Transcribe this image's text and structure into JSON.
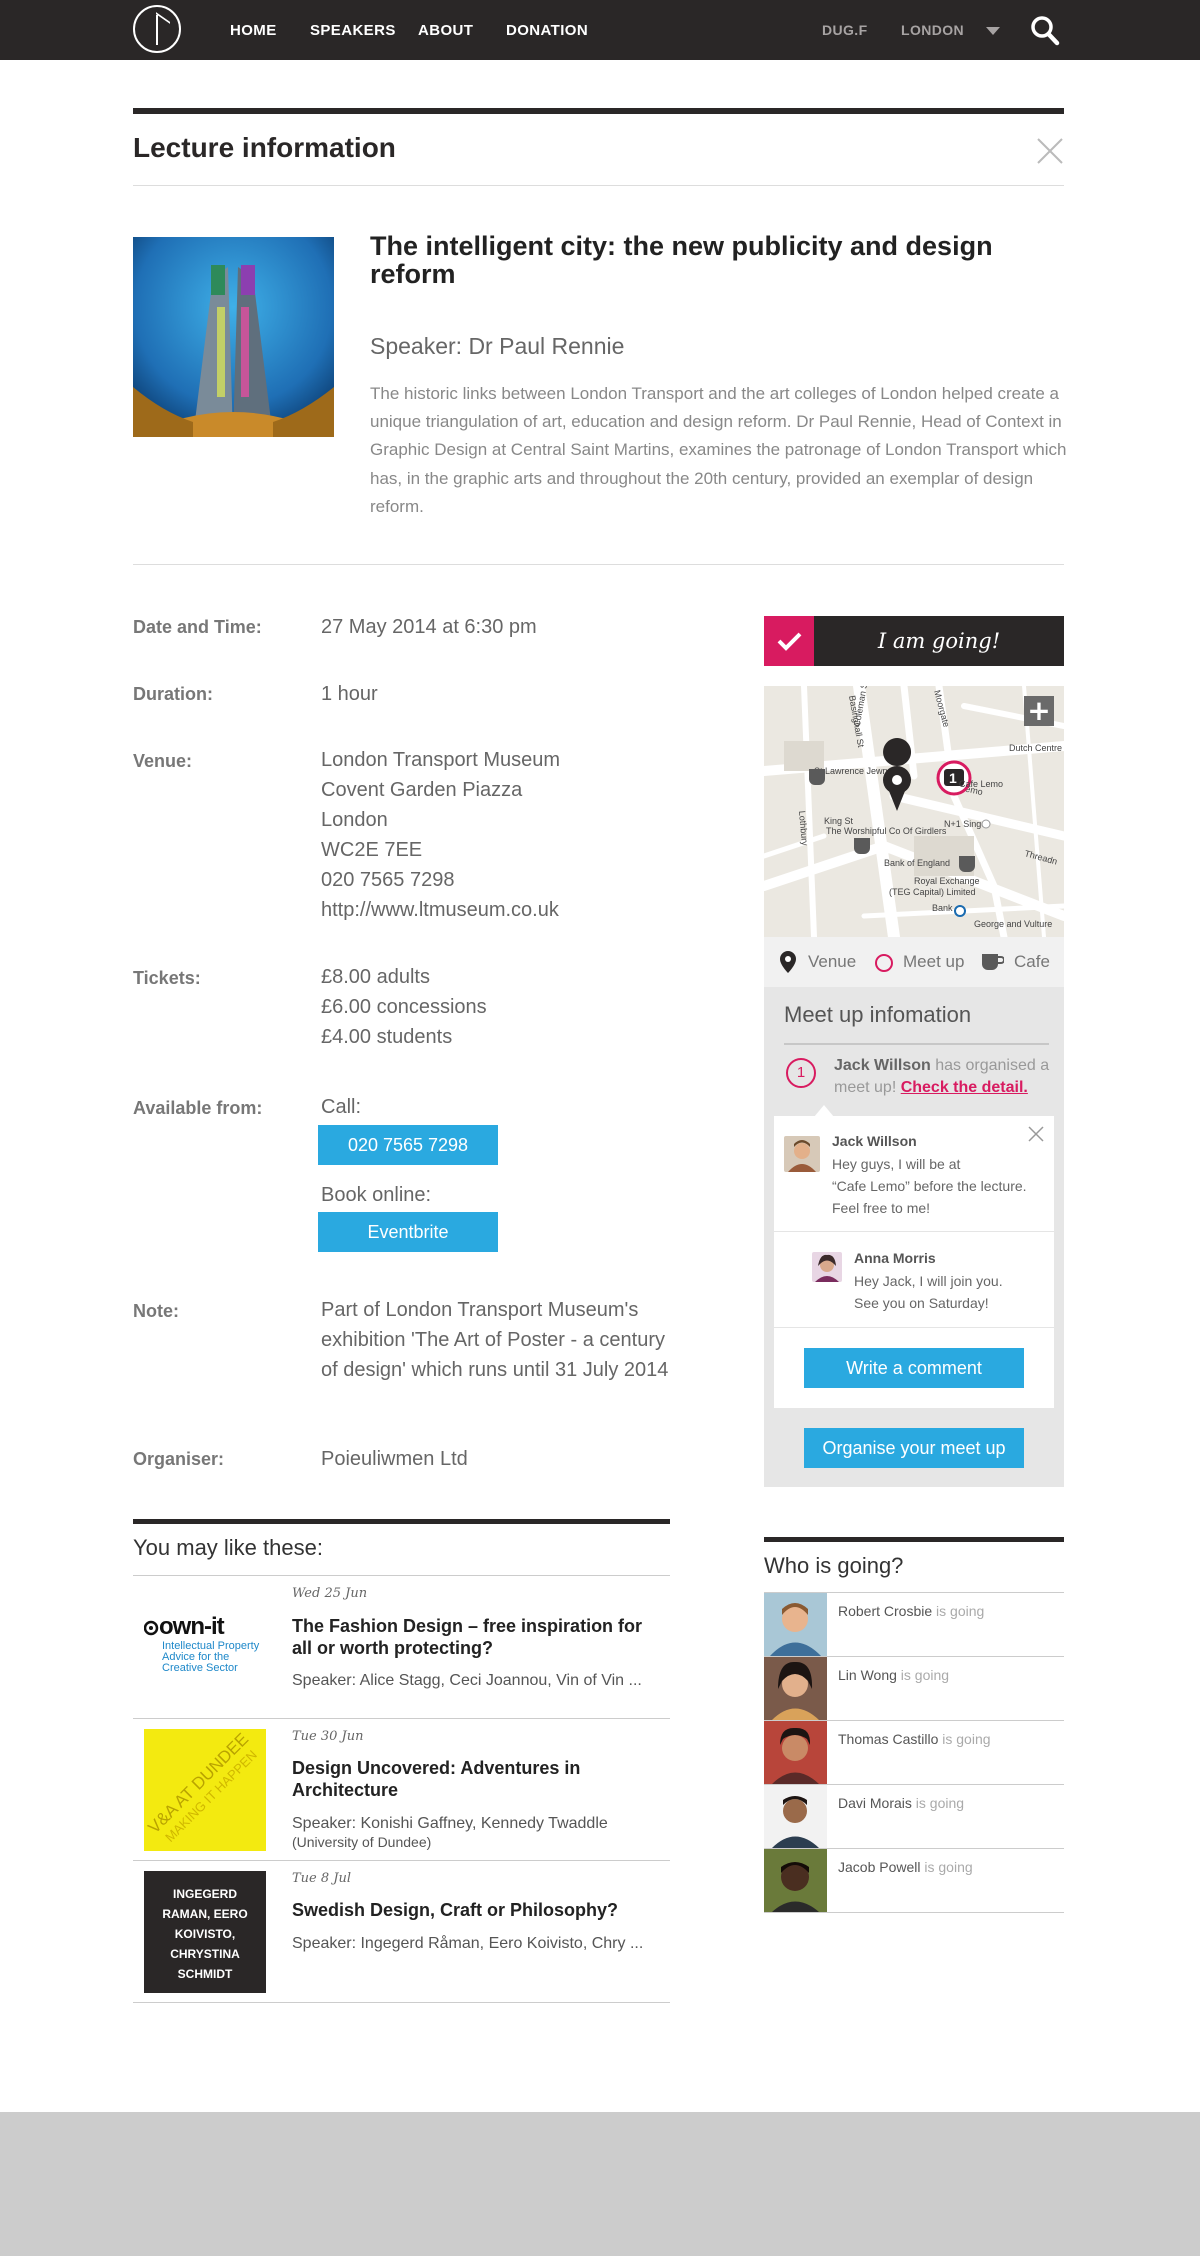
{
  "nav": {
    "items": [
      "HOME",
      "SPEAKERS",
      "ABOUT",
      "DONATION"
    ],
    "user": "DUG.F",
    "city": "LONDON"
  },
  "page_title": "Lecture information",
  "lecture": {
    "title": "The intelligent city: the new publicity and design reform",
    "speaker": "Speaker: Dr Paul Rennie",
    "description": "The historic links between London Transport and the art colleges of London helped create a unique triangulation of art, education and design reform.  Dr Paul Rennie, Head of Context in Graphic Design at Central Saint Martins, examines the patronage of London Transport which has, in the graphic arts and throughout the 20th century, provided an exemplar of design reform."
  },
  "details": {
    "date_label": "Date and Time:",
    "date_value": "27 May 2014 at 6:30 pm",
    "duration_label": "Duration:",
    "duration_value": "1 hour",
    "venue_label": "Venue:",
    "venue_lines": [
      "London Transport Museum",
      "Covent Garden Piazza",
      "London",
      "WC2E 7EE",
      "020 7565 7298",
      "http://www.ltmuseum.co.uk"
    ],
    "tickets_label": "Tickets:",
    "ticket_lines": [
      "£8.00 adults",
      "£6.00 concessions",
      "£4.00 students"
    ],
    "available_label": "Available from:",
    "call_label": "Call:",
    "call_button": "020 7565 7298",
    "book_label": "Book online:",
    "book_button": "Eventbrite",
    "note_label": "Note:",
    "note_lines": [
      "Part of London Transport Museum's",
      "exhibition 'The Art of Poster - a century",
      "of design' which runs until 31 July 2014"
    ],
    "organiser_label": "Organiser:",
    "organiser_value": "Poieuliwmen Ltd"
  },
  "going_button": "I am going!",
  "map": {
    "labels": [
      "Basinghall St",
      "Coleman St",
      "Moorgate",
      "Dutch Centre",
      "St Lawrence Jewry",
      "Cafe Lemo",
      "Lothbury",
      "King St",
      "The Worshipful Co Of Girdlers",
      "N+1 Singer",
      "Bank of England",
      "Royal Exchange",
      "(TEG Capital) Limited",
      "Bank",
      "George and Vulture",
      "Threadn"
    ],
    "meetup_count": "1"
  },
  "legend": {
    "venue": "Venue",
    "meetup": "Meet up",
    "cafe": "Cafe"
  },
  "meetup": {
    "title": "Meet up infomation",
    "count": "1",
    "organiser": "Jack Willson",
    "text": " has organised a meet up! ",
    "link": "Check the detail.",
    "comments": [
      {
        "name": "Jack Willson",
        "lines": [
          "Hey guys, I will be at",
          "“Cafe Lemo” before the lecture.",
          "Feel free to me!"
        ]
      },
      {
        "name": "Anna Morris",
        "lines": [
          "Hey Jack, I will join you.",
          "See you on Saturday!"
        ]
      }
    ],
    "write_button": "Write a comment",
    "organise_button": "Organise your meet up"
  },
  "related": {
    "title": "You may like these:",
    "items": [
      {
        "date": "Wed 25 Jun",
        "title": "The Fashion Design – free inspiration for all or worth protecting?",
        "speaker": "Speaker: Alice Stagg, Ceci Joannou, Vin of Vin ...",
        "thumb_main": "own-it",
        "thumb_lines": [
          "Intellectual Property",
          "Advice for the",
          "Creative Sector"
        ]
      },
      {
        "date": "Tue 30 Jun",
        "title": "Design Uncovered: Adventures in Architecture",
        "speaker": "Speaker: Konishi Gaffney, Kennedy Twaddle",
        "speaker_sub": "(University of Dundee)",
        "thumb_lines": [
          "V&A AT DUNDEE",
          "MAKING IT HAPPEN"
        ]
      },
      {
        "date": "Tue 8 Jul",
        "title": "Swedish Design, Craft or Philosophy?",
        "speaker": "Speaker: Ingegerd Råman, Eero Koivisto, Chry ...",
        "thumb_lines": [
          "INGEGERD",
          "RAMAN, EERO",
          "KOIVISTO,",
          "CHRYSTINA",
          "SCHMIDT"
        ]
      }
    ]
  },
  "who": {
    "title": "Who is going?",
    "status": " is going",
    "people": [
      "Robert Crosbie",
      "Lin Wong",
      "Thomas Castillo",
      "Davi Morais",
      "Jacob Powell"
    ]
  },
  "colors": {
    "dark": "#2a2727",
    "accent_pink": "#d81b60",
    "accent_blue": "#2aa9e0",
    "panel_grey": "#e6e6e6",
    "footer_grey": "#cccccc"
  },
  "icons": [
    "logo-icon",
    "chevron-down-icon",
    "search-icon",
    "close-icon",
    "check-icon",
    "plus-icon",
    "venue-pin-icon",
    "meetup-ring-icon",
    "cafe-cup-icon"
  ]
}
